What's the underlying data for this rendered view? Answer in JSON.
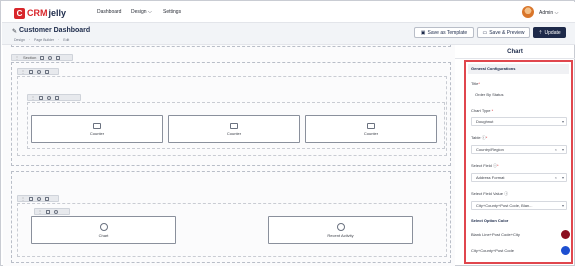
{
  "brand": {
    "badge": "C",
    "part1": "CRM",
    "part2": "jelly"
  },
  "nav": {
    "dashboard": "Dashboard",
    "design": "Design",
    "design_chev": "⌵",
    "settings": "Settings",
    "admin": "Admin",
    "admin_chev": "⌵"
  },
  "header": {
    "title": "Customer Dashboard",
    "breadcrumb": [
      "Design",
      "Page Builder",
      "Edit"
    ],
    "save_template": "Save as Template",
    "save_preview": "Save & Preview",
    "update": "Update"
  },
  "builder": {
    "section_label": "Section",
    "row1": [
      "Counter",
      "Counter",
      "Counter"
    ],
    "row2": [
      "Chart",
      "Recent Activity"
    ]
  },
  "panel": {
    "title": "Chart",
    "group": "General Configurations",
    "title_label": "Title",
    "title_value": "Order By Status",
    "chart_type_label": "Chart Type",
    "chart_type_value": "Doughnut",
    "table_label": "Table",
    "table_value": "Country/Region",
    "field_label": "Select Field",
    "field_value": "Address Format",
    "field_value_label": "Select Field Value",
    "field_value_value": "City+County+Post Code, Blan...",
    "option_color_label": "Select Option Color",
    "options": [
      {
        "label": "Blank Line+Post Code+City",
        "color": "#8b1020"
      },
      {
        "label": "City+County+Post Code",
        "color": "#1d4fd1"
      }
    ]
  }
}
